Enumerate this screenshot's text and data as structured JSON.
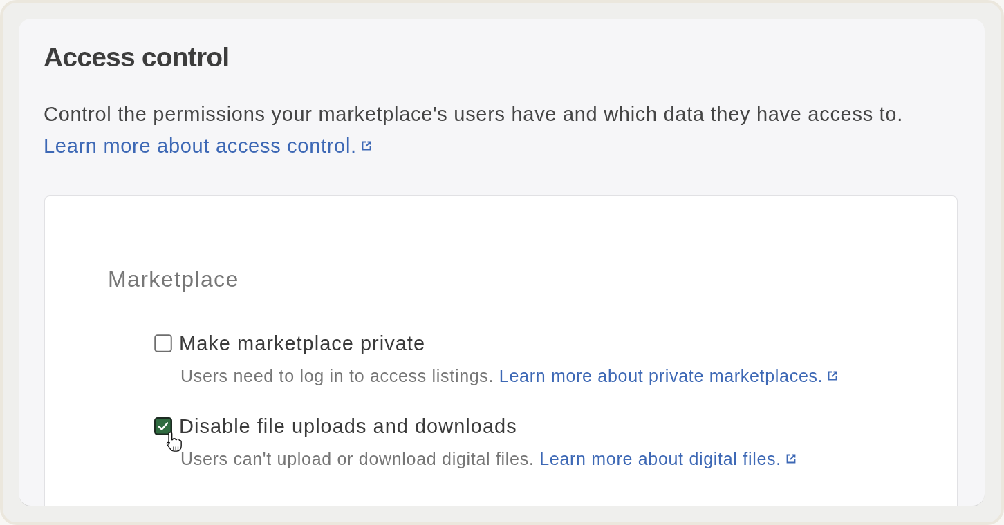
{
  "page": {
    "title": "Access control",
    "description": "Control the permissions your marketplace's users have and which data they have access to.",
    "link": "Learn more about access control."
  },
  "section": {
    "title": "Marketplace",
    "options": [
      {
        "label": "Make marketplace private",
        "checked": false,
        "description": "Users need to log in to access listings.",
        "link": "Learn more about private marketplaces."
      },
      {
        "label": "Disable file uploads and downloads",
        "checked": true,
        "description": "Users can't upload or download digital files.",
        "link": "Learn more about digital files."
      }
    ]
  }
}
